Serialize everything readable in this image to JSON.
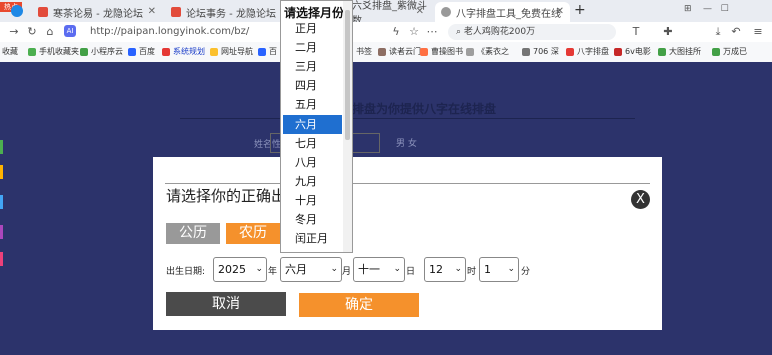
{
  "browser": {
    "tabs": [
      {
        "label": "寒茶论易 - 龙隐论坛"
      },
      {
        "label": "论坛事务 - 龙隐论坛"
      },
      {
        "label": "六爻排盘_紫微斗数"
      },
      {
        "label": "八字排盘工具_免费在线生辰八"
      }
    ],
    "badge": "热点",
    "address": "http://paipan.longyinok.com/bz/",
    "search_text": "老人鸡购花200万",
    "bookmarks": [
      "收藏",
      "手机收藏夹",
      "小程序云",
      "百度",
      "系统规划",
      "网址导航",
      "百",
      "书签",
      "读者云门",
      "曹操图书",
      "《素衣之",
      "706 深",
      "八字排盘",
      "6v电影",
      "大图挂所",
      "万成已"
    ]
  },
  "page": {
    "title": "排盘为你提供八字在线排盘",
    "name_label": "姓名性别:",
    "radio_text": "男 女"
  },
  "modal": {
    "title": "请选择你的正确出",
    "close_label": "X",
    "solar_label": "公历",
    "lunar_label": "农历",
    "birth_label": "出生日期:",
    "year": "2025",
    "year_unit": "年",
    "month": "六月",
    "month_unit": "月",
    "day": "十一",
    "day_unit": "日",
    "hour": "12",
    "hour_unit": "时",
    "minute": "1",
    "minute_unit": "分",
    "cancel_label": "取消",
    "ok_label": "确定"
  },
  "dropdown": {
    "header": "请选择月份",
    "options": [
      "正月",
      "二月",
      "三月",
      "四月",
      "五月",
      "六月",
      "七月",
      "八月",
      "九月",
      "十月",
      "冬月",
      "闰正月"
    ],
    "selected": "六月"
  },
  "colors": {
    "page_bg": "#2c336b",
    "accent_orange": "#f5912c",
    "selected_blue": "#1f6fd0"
  }
}
